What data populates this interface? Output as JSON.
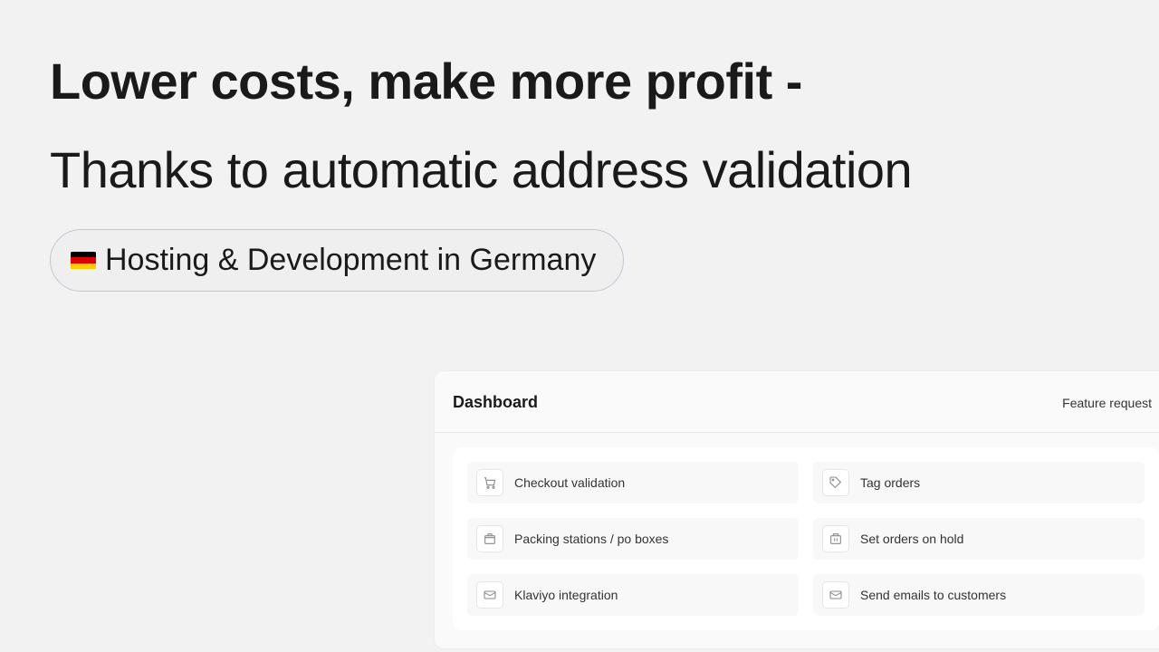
{
  "hero": {
    "title": "Lower costs, make more profit -",
    "subtitle": "Thanks to automatic address validation",
    "badge_text": "Hosting & Development in Germany"
  },
  "dashboard": {
    "title": "Dashboard",
    "feature_request": "Feature request",
    "items": [
      {
        "label": "Checkout validation"
      },
      {
        "label": "Tag orders"
      },
      {
        "label": "Packing stations / po boxes"
      },
      {
        "label": "Set orders on hold"
      },
      {
        "label": "Klaviyo integration"
      },
      {
        "label": "Send emails to customers"
      }
    ]
  }
}
